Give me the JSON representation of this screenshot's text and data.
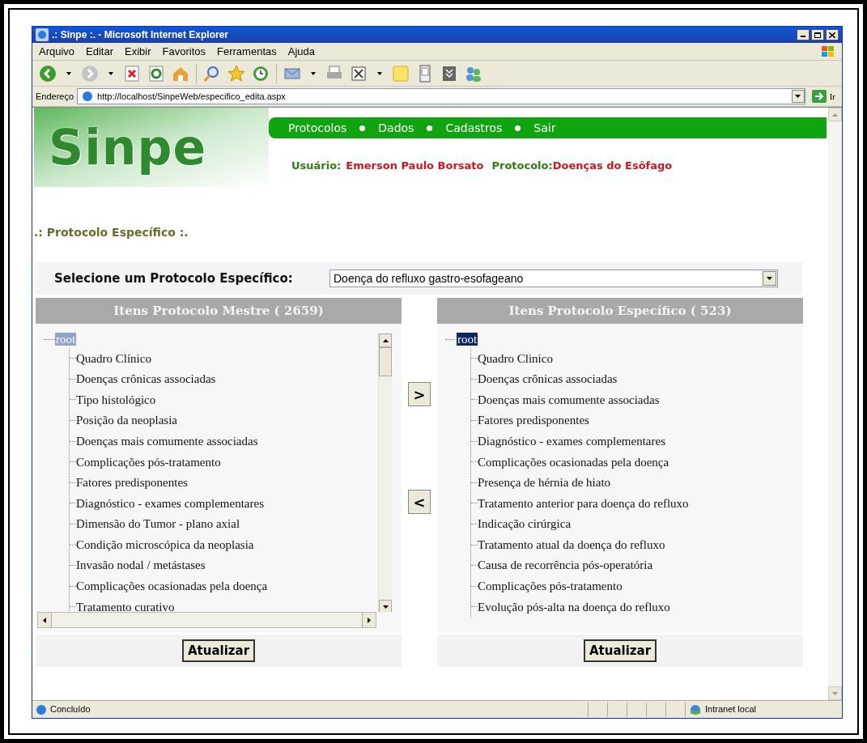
{
  "window": {
    "title": ".: Sinpe :. - Microsoft Internet Explorer"
  },
  "menu": [
    "Arquivo",
    "Editar",
    "Exibir",
    "Favoritos",
    "Ferramentas",
    "Ajuda"
  ],
  "address": {
    "label": "Endereço",
    "url": "http://localhost/SinpeWeb/especifico_edita.aspx",
    "go": "Ir"
  },
  "logo": "Sinpe",
  "nav": [
    "Protocolos",
    "Dados",
    "Cadastros",
    "Sair"
  ],
  "user": {
    "label": "Usuário:",
    "name": "Emerson Paulo Borsato",
    "protocol_label": "Protocolo:",
    "protocol": "Doenças do Esôfago"
  },
  "heading": ".: Protocolo Específico :.",
  "select": {
    "label": "Selecione um Protocolo Específico:",
    "value": "Doença do refluxo gastro-esofageano"
  },
  "panels": [
    {
      "title": "Itens Protocolo Mestre ( 2659)",
      "scrollable": true,
      "tree": {
        "label": "root",
        "selected": true,
        "focused": false,
        "children": [
          {
            "label": "Quadro Clínico"
          },
          {
            "label": "Doenças crônicas associadas"
          },
          {
            "label": "Tipo histológico"
          },
          {
            "label": "Posição da neoplasia"
          },
          {
            "label": "Doenças mais comumente associadas"
          },
          {
            "label": "Complicações pós-tratamento"
          },
          {
            "label": "Fatores predisponentes"
          },
          {
            "label": "Diagnóstico - exames complementares"
          },
          {
            "label": "Dimensão do Tumor - plano axial"
          },
          {
            "label": "Condição microscópica da neoplasia"
          },
          {
            "label": "Invasão nodal / metástases"
          },
          {
            "label": "Complicações ocasionadas pela doença"
          },
          {
            "label": "Tratamento curativo"
          }
        ]
      },
      "button": "Atualizar"
    },
    {
      "title": "Itens Protocolo Específico ( 523)",
      "scrollable": false,
      "tree": {
        "label": "root",
        "selected": true,
        "focused": true,
        "children": [
          {
            "label": "Quadro Clinico"
          },
          {
            "label": "Doenças crônicas associadas"
          },
          {
            "label": "Doenças mais comumente associadas"
          },
          {
            "label": "Fatores predisponentes"
          },
          {
            "label": "Diagnóstico - exames complementares"
          },
          {
            "label": "Complicações ocasionadas pela doença"
          },
          {
            "label": "Presença de hérnia de hiato"
          },
          {
            "label": "Tratamento anterior para doença do refluxo"
          },
          {
            "label": "Indicação cirúrgica"
          },
          {
            "label": "Tratamento atual da doença do refluxo"
          },
          {
            "label": "Causa de recorrência pós-operatória"
          },
          {
            "label": "Complicações pós-tratamento"
          },
          {
            "label": "Evolução pós-alta na doença do refluxo"
          }
        ]
      },
      "button": "Atualizar"
    }
  ],
  "move_buttons": [
    ">",
    "<"
  ],
  "status": {
    "text": "Concluído",
    "zone": "Intranet local"
  }
}
